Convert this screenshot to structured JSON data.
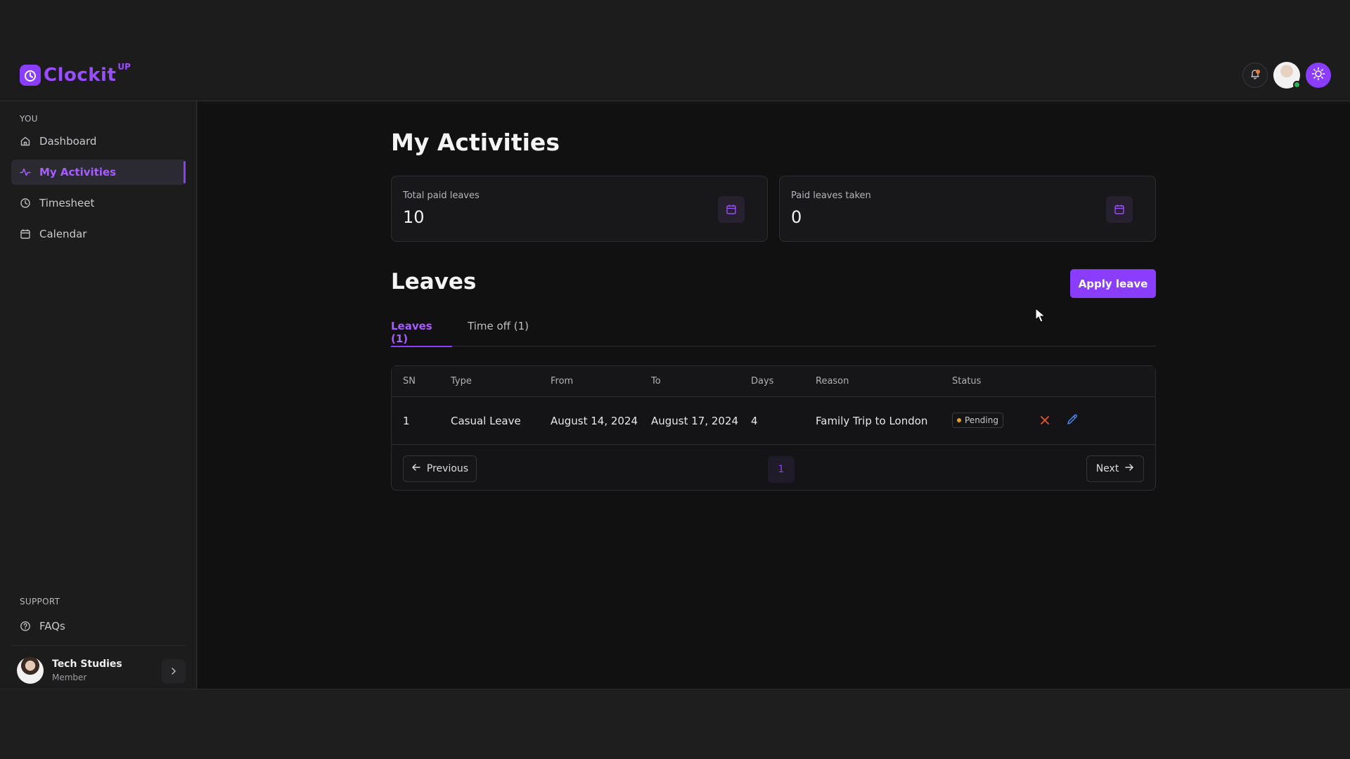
{
  "app": {
    "name": "Clockit",
    "name_sup": "UP",
    "accent_color": "#8b3dff"
  },
  "header": {
    "icons": [
      "bell-icon",
      "user-avatar",
      "sun-icon"
    ]
  },
  "sidebar": {
    "section_you": "YOU",
    "items": [
      {
        "label": "Dashboard",
        "icon": "home-icon"
      },
      {
        "label": "My Activities",
        "icon": "activity-icon"
      },
      {
        "label": "Timesheet",
        "icon": "clock-icon"
      },
      {
        "label": "Calendar",
        "icon": "calendar-icon"
      }
    ],
    "active_item": "My Activities",
    "section_support": "SUPPORT",
    "support_items": [
      {
        "label": "FAQs",
        "icon": "help-circle-icon"
      }
    ],
    "user": {
      "name": "Tech Studies",
      "role": "Member"
    }
  },
  "main": {
    "title": "My Activities",
    "stats": [
      {
        "label": "Total paid leaves",
        "value": "10",
        "icon": "calendar-icon"
      },
      {
        "label": "Paid leaves taken",
        "value": "0",
        "icon": "calendar-icon"
      }
    ],
    "leaves_title": "Leaves",
    "apply_button": "Apply leave",
    "tabs": [
      {
        "label": "Leaves (1)",
        "active": true
      },
      {
        "label": "Time off (1)",
        "active": false
      }
    ],
    "table": {
      "columns": [
        "SN",
        "Type",
        "From",
        "To",
        "Days",
        "Reason",
        "Status"
      ],
      "rows": [
        {
          "sn": "1",
          "type": "Casual Leave",
          "from": "August 14, 2024",
          "to": "August 17, 2024",
          "days": "4",
          "reason": "Family Trip to London",
          "status": "Pending"
        }
      ]
    },
    "pagination": {
      "previous": "Previous",
      "next": "Next",
      "current_page": "1"
    }
  }
}
